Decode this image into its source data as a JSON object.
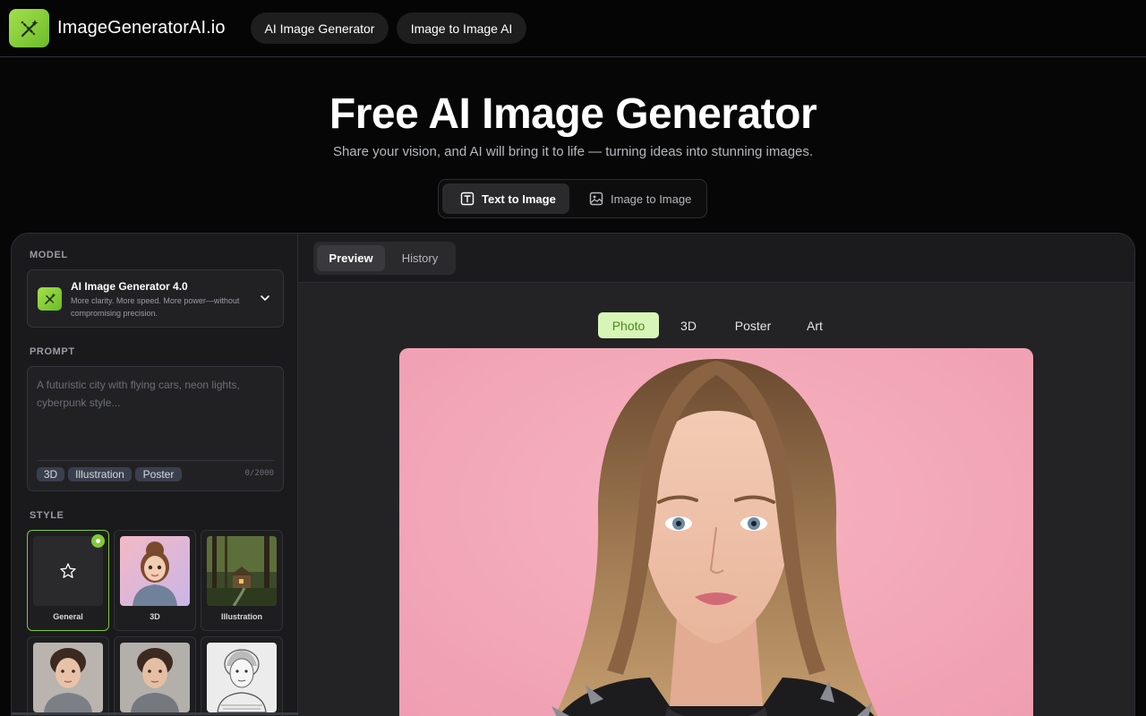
{
  "brand": {
    "name": "ImageGeneratorAI.io",
    "logo_icon": "magic-wand-icon"
  },
  "nav": {
    "items": [
      "AI Image Generator",
      "Image to Image AI"
    ]
  },
  "hero": {
    "title": "Free AI Image Generator",
    "subtitle": "Share your vision, and AI will bring it to life — turning ideas into stunning images."
  },
  "mode_switch": {
    "options": [
      {
        "label": "Text to Image",
        "icon": "text-icon",
        "active": true
      },
      {
        "label": "Image to Image",
        "icon": "image-icon",
        "active": false
      }
    ]
  },
  "sidebar": {
    "model": {
      "section_label": "MODEL",
      "name": "AI Image Generator 4.0",
      "description": "More clarity. More speed. More power—without compromising precision."
    },
    "prompt": {
      "section_label": "PROMPT",
      "value": "",
      "placeholder": "A futuristic city with flying cars, neon lights, cyberpunk style...",
      "tags": [
        "3D",
        "Illustration",
        "Poster"
      ],
      "char_count": "0/2000"
    },
    "style": {
      "section_label": "STYLE",
      "cards": [
        {
          "label": "General",
          "selected": true
        },
        {
          "label": "3D",
          "selected": false
        },
        {
          "label": "Illustration",
          "selected": false
        },
        {
          "label": "",
          "selected": false
        },
        {
          "label": "",
          "selected": false
        },
        {
          "label": "",
          "selected": false
        }
      ]
    }
  },
  "preview": {
    "tabs": [
      {
        "label": "Preview",
        "active": true
      },
      {
        "label": "History",
        "active": false
      }
    ],
    "categories": [
      {
        "label": "Photo",
        "active": true
      },
      {
        "label": "3D",
        "active": false
      },
      {
        "label": "Poster",
        "active": false
      },
      {
        "label": "Art",
        "active": false
      }
    ]
  },
  "colors": {
    "accent_green": "#7fc93a",
    "background": "#060606",
    "panel": "#1b1b1d",
    "preview_bg": "#232325",
    "photo_backdrop": "#f4a7b5"
  }
}
